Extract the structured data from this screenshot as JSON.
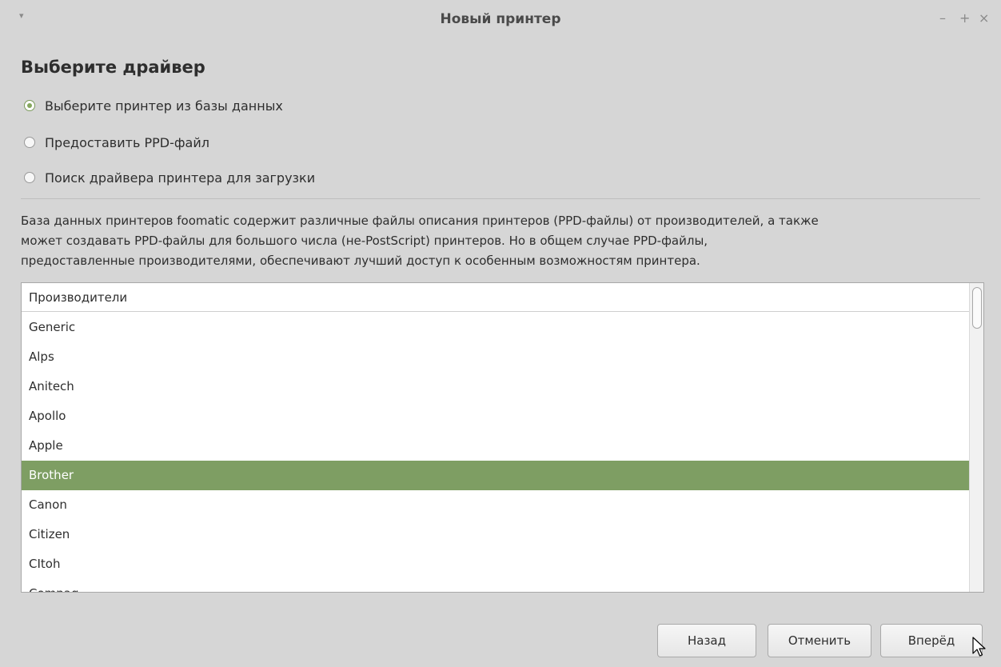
{
  "window": {
    "title": "Новый принтер",
    "menu_glyph": "▾",
    "minimize_glyph": "–",
    "maximize_glyph": "+",
    "close_glyph": "×"
  },
  "heading": "Выберите драйвер",
  "options": [
    {
      "label": "Выберите принтер из базы данных",
      "selected": true
    },
    {
      "label": "Предоставить PPD-файл",
      "selected": false
    },
    {
      "label": "Поиск драйвера принтера для загрузки",
      "selected": false
    }
  ],
  "description": {
    "line1": "База данных принтеров foomatic содержит различные файлы описания принтеров (PPD-файлы) от производителей, а также",
    "line2": "может создавать PPD-файлы для большого числа (не-PostScript) принтеров. Но в общем случае PPD-файлы,",
    "line3": "предоставленные производителями, обеспечивают лучший доступ к особенным возможностям принтера."
  },
  "manufacturers": {
    "header": "Производители",
    "items": [
      "Generic",
      "Alps",
      "Anitech",
      "Apollo",
      "Apple",
      "Brother",
      "Canon",
      "Citizen",
      "CItoh",
      "Compaq"
    ],
    "selected": "Brother"
  },
  "buttons": {
    "back": "Назад",
    "cancel": "Отменить",
    "forward": "Вперёд"
  },
  "colors": {
    "selection": "#7e9e63",
    "radio_accent": "#85a75e",
    "background": "#d6d6d6"
  }
}
